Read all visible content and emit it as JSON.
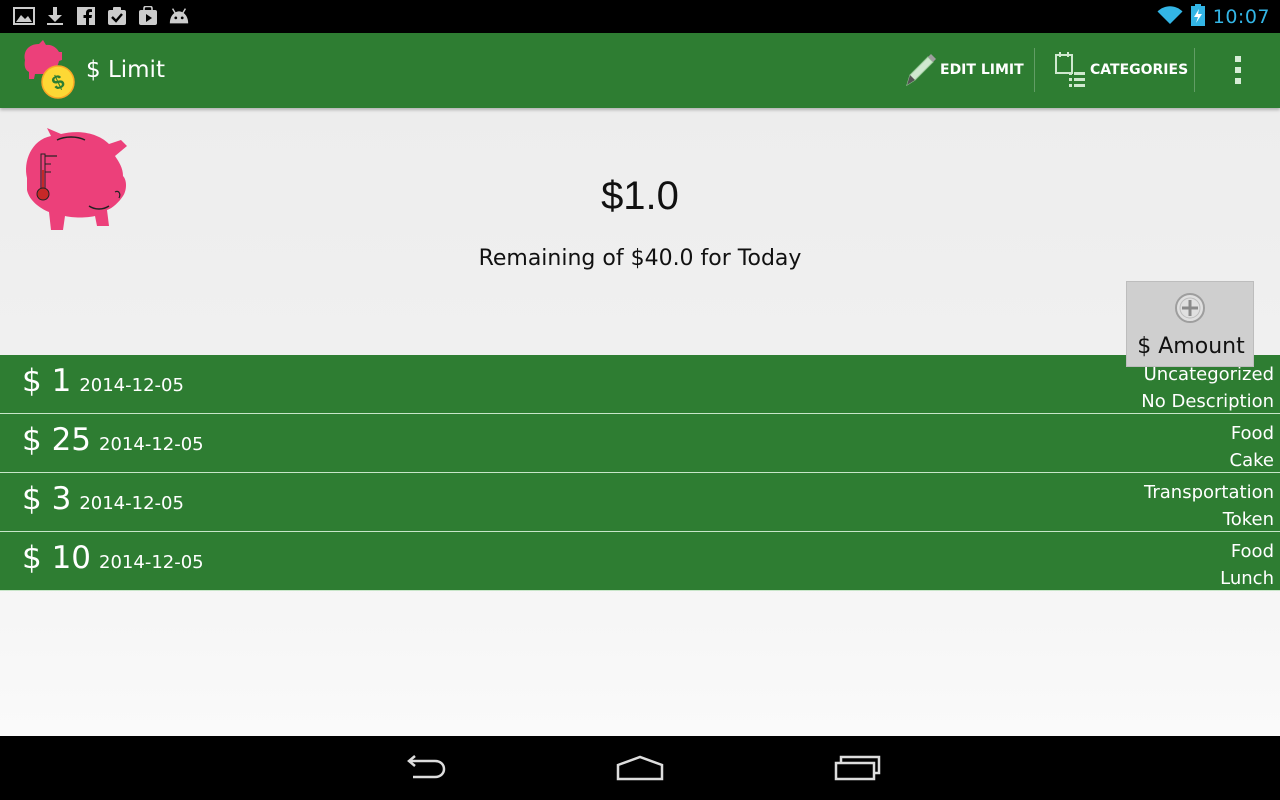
{
  "status_bar": {
    "time": "10:07",
    "clock_color": "#33b5e5",
    "left_icons": [
      "picture-icon",
      "download-icon",
      "facebook-icon",
      "clipboard-check-icon",
      "play-store-icon",
      "android-icon"
    ],
    "right_icons": [
      "wifi-icon",
      "battery-charging-icon"
    ]
  },
  "app_bar": {
    "title": "$ Limit",
    "background_color": "#2e7d32",
    "actions": [
      {
        "label": "EDIT LIMIT",
        "icon": "pencil-icon"
      },
      {
        "label": "CATEGORIES",
        "icon": "categories-list-icon"
      }
    ],
    "overflow_icon": "overflow-menu-icon"
  },
  "summary": {
    "remaining_amount": "$1.0",
    "remaining_text": "Remaining of $40.0 for Today"
  },
  "add_amount_button": {
    "label": "$ Amount",
    "icon": "plus-circle-icon"
  },
  "expenses": [
    {
      "amount": "$ 1",
      "date": "2014-12-05",
      "category": "Uncategorized",
      "description": "No Description"
    },
    {
      "amount": "$ 25",
      "date": "2014-12-05",
      "category": "Food",
      "description": "Cake"
    },
    {
      "amount": "$ 3",
      "date": "2014-12-05",
      "category": "Transportation",
      "description": "Token"
    },
    {
      "amount": "$ 10",
      "date": "2014-12-05",
      "category": "Food",
      "description": "Lunch"
    }
  ],
  "nav_bar": {
    "buttons": [
      "back-icon",
      "home-icon",
      "recent-apps-icon"
    ]
  }
}
